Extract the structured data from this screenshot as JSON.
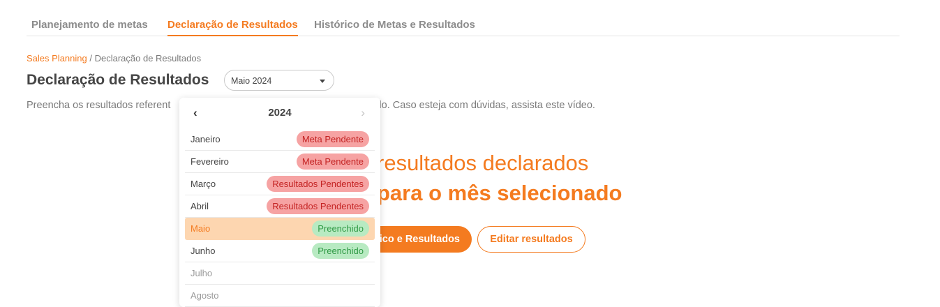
{
  "tabs": [
    {
      "label": "Planejamento de metas"
    },
    {
      "label": "Declaração de Resultados"
    },
    {
      "label": "Histórico de Metas e Resultados"
    }
  ],
  "breadcrumb": {
    "link": "Sales Planning",
    "separator": "/",
    "current": "Declaração de Resultados"
  },
  "page_title": "Declaração de Resultados",
  "month_select": {
    "value": "Maio 2024"
  },
  "subtitle": {
    "visible_left": "Preencha os resultados referent",
    "visible_right": "selecionado. Caso esteja com dúvidas, assista este vídeo."
  },
  "empty_state": {
    "line1": "resultados declarados",
    "line2": "para o mês selecionado"
  },
  "buttons": {
    "primary_label": "ico e Resultados",
    "edit_label": "Editar resultados"
  },
  "dropdown": {
    "year": "2024",
    "prev_icon": "chevron-left-icon",
    "next_icon": "chevron-right-icon",
    "months": [
      {
        "label": "Janeiro",
        "badge": "Meta Pendente"
      },
      {
        "label": "Fevereiro",
        "badge": "Meta Pendente"
      },
      {
        "label": "Março",
        "badge": "Resultados Pendentes"
      },
      {
        "label": "Abril",
        "badge": "Resultados Pendentes"
      },
      {
        "label": "Maio",
        "badge": "Preenchido"
      },
      {
        "label": "Junho",
        "badge": "Preenchido"
      },
      {
        "label": "Julho",
        "badge": null
      },
      {
        "label": "Agosto",
        "badge": null
      }
    ]
  },
  "colors": {
    "accent": "#f47b20",
    "selected_row": "#fdd6b0",
    "badge_pending_bg": "#f6a3a3",
    "badge_pending_text": "#c42323",
    "badge_done_bg": "#b8eac2",
    "badge_done_text": "#2f9a45"
  }
}
